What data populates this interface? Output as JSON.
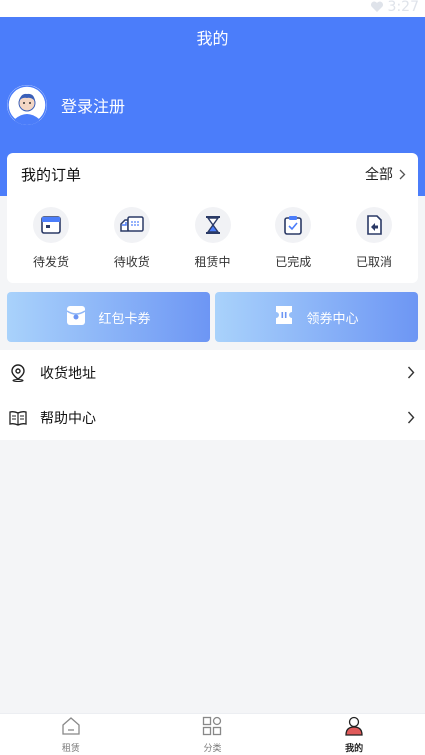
{
  "status": {
    "time": "3:27"
  },
  "header": {
    "title": "我的"
  },
  "profile": {
    "login_text": "登录注册"
  },
  "orders": {
    "title": "我的订单",
    "all_label": "全部",
    "items": [
      {
        "label": "待发货",
        "icon": "pending-ship-icon"
      },
      {
        "label": "待收货",
        "icon": "delivery-truck-icon"
      },
      {
        "label": "租赁中",
        "icon": "hourglass-icon"
      },
      {
        "label": "已完成",
        "icon": "clipboard-check-icon"
      },
      {
        "label": "已取消",
        "icon": "cancel-return-icon"
      }
    ]
  },
  "coupons": {
    "red_packet_label": "红包卡券",
    "coupon_center_label": "领券中心"
  },
  "menu": {
    "items": [
      {
        "label": "收货地址",
        "icon": "location-pin-icon"
      },
      {
        "label": "帮助中心",
        "icon": "book-icon"
      }
    ]
  },
  "tabbar": {
    "items": [
      {
        "label": "租赁",
        "icon": "home-icon",
        "active": false
      },
      {
        "label": "分类",
        "icon": "category-grid-icon",
        "active": false
      },
      {
        "label": "我的",
        "icon": "user-icon",
        "active": true
      }
    ]
  },
  "colors": {
    "primary": "#4b7dfa",
    "background": "#f4f5f7",
    "accent_red": "#e05a5a"
  }
}
